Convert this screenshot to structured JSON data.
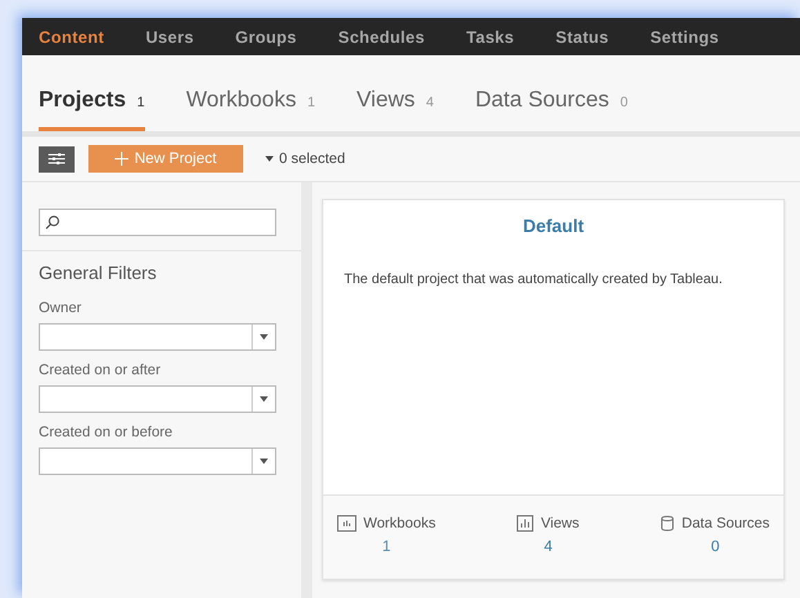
{
  "nav": [
    {
      "label": "Content",
      "selected": true
    },
    {
      "label": "Users",
      "selected": false
    },
    {
      "label": "Groups",
      "selected": false
    },
    {
      "label": "Schedules",
      "selected": false
    },
    {
      "label": "Tasks",
      "selected": false
    },
    {
      "label": "Status",
      "selected": false
    },
    {
      "label": "Settings",
      "selected": false
    }
  ],
  "tabs": [
    {
      "label": "Projects",
      "count": "1",
      "selected": true
    },
    {
      "label": "Workbooks",
      "count": "1",
      "selected": false
    },
    {
      "label": "Views",
      "count": "4",
      "selected": false
    },
    {
      "label": "Data Sources",
      "count": "0",
      "selected": false
    }
  ],
  "toolbar": {
    "new_button": "New Project",
    "selection": "0 selected"
  },
  "sidebar": {
    "heading": "General Filters",
    "filters": [
      {
        "label": "Owner"
      },
      {
        "label": "Created on or after"
      },
      {
        "label": "Created on or before"
      }
    ]
  },
  "card": {
    "title": "Default",
    "description": "The default project that was automatically created by Tableau.",
    "stats": [
      {
        "kind": "workbooks",
        "label": "Workbooks",
        "value": "1"
      },
      {
        "kind": "views",
        "label": "Views",
        "value": "4"
      },
      {
        "kind": "datasources",
        "label": "Data Sources",
        "value": "0"
      }
    ]
  }
}
